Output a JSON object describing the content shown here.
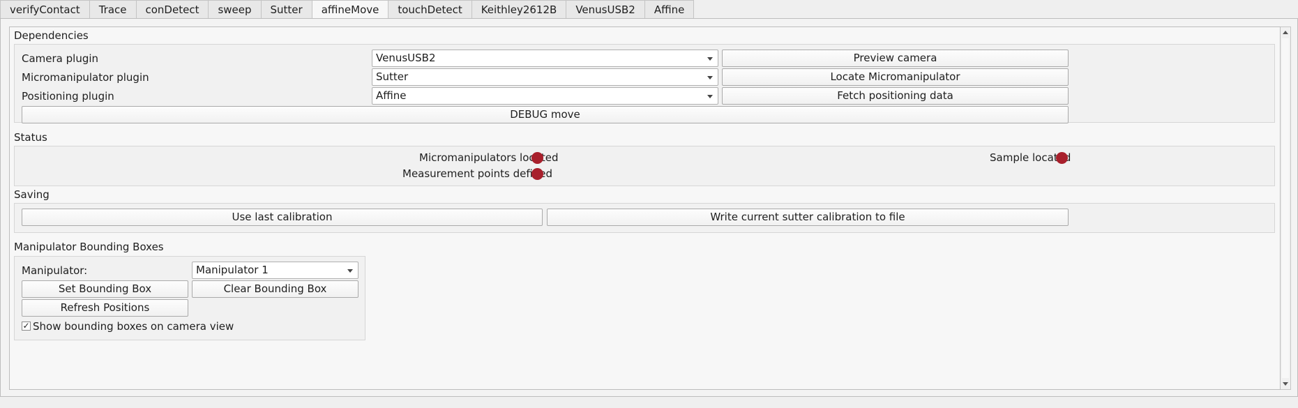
{
  "tabs": [
    {
      "label": "verifyContact",
      "active": false
    },
    {
      "label": "Trace",
      "active": false
    },
    {
      "label": "conDetect",
      "active": false
    },
    {
      "label": "sweep",
      "active": false
    },
    {
      "label": "Sutter",
      "active": false
    },
    {
      "label": "affineMove",
      "active": true
    },
    {
      "label": "touchDetect",
      "active": false
    },
    {
      "label": "Keithley2612B",
      "active": false
    },
    {
      "label": "VenusUSB2",
      "active": false
    },
    {
      "label": "Affine",
      "active": false
    }
  ],
  "dependencies": {
    "title": "Dependencies",
    "camera_label": "Camera plugin",
    "camera_value": "VenusUSB2",
    "preview_camera": "Preview camera",
    "micromanipulator_label": "Micromanipulator plugin",
    "micromanipulator_value": "Sutter",
    "locate_micromanipulator": "Locate Micromanipulator",
    "positioning_label": "Positioning plugin",
    "positioning_value": "Affine",
    "fetch_positioning": "Fetch positioning data",
    "debug_move": "DEBUG move"
  },
  "status": {
    "title": "Status",
    "micromanipulators_located": "Micromanipulators located",
    "measurement_points_defined": "Measurement points defined",
    "sample_located": "Sample located",
    "indicator_color": "#a8202c"
  },
  "saving": {
    "title": "Saving",
    "use_last_calibration": "Use last calibration",
    "write_calibration": "Write current sutter calibration to file"
  },
  "bounding_boxes": {
    "title": "Manipulator Bounding Boxes",
    "manipulator_label": "Manipulator:",
    "manipulator_value": "Manipulator 1",
    "set_bounding_box": "Set Bounding Box",
    "clear_bounding_box": "Clear Bounding Box",
    "refresh_positions": "Refresh Positions",
    "show_checkbox_label": "Show bounding boxes on camera view",
    "show_checkbox_checked": true,
    "check_glyph": "✓"
  }
}
